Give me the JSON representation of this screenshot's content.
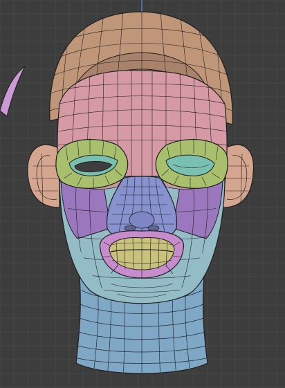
{
  "viewport": {
    "background": "#3d3d3d",
    "grid_color": "#474747",
    "axis_color": "#5b7fbf",
    "wire_color": "#1e1e1e"
  },
  "model": {
    "colors": {
      "skullcap": "#c09679",
      "skullcap_inner": "#a9826b",
      "forehead": "#d69aa5",
      "eye_ring": "#a8bf6d",
      "eye_socket": "#79c0b0",
      "nose": "#8792cf",
      "cheek": "#9b77bd",
      "cheek_band": "#c79aa1",
      "mouth_ring": "#c68ccc",
      "lips": "#c9c27c",
      "chin_jaw": "#93bcc7",
      "neck": "#7fa7c6",
      "ear": "#d4a58f"
    }
  }
}
